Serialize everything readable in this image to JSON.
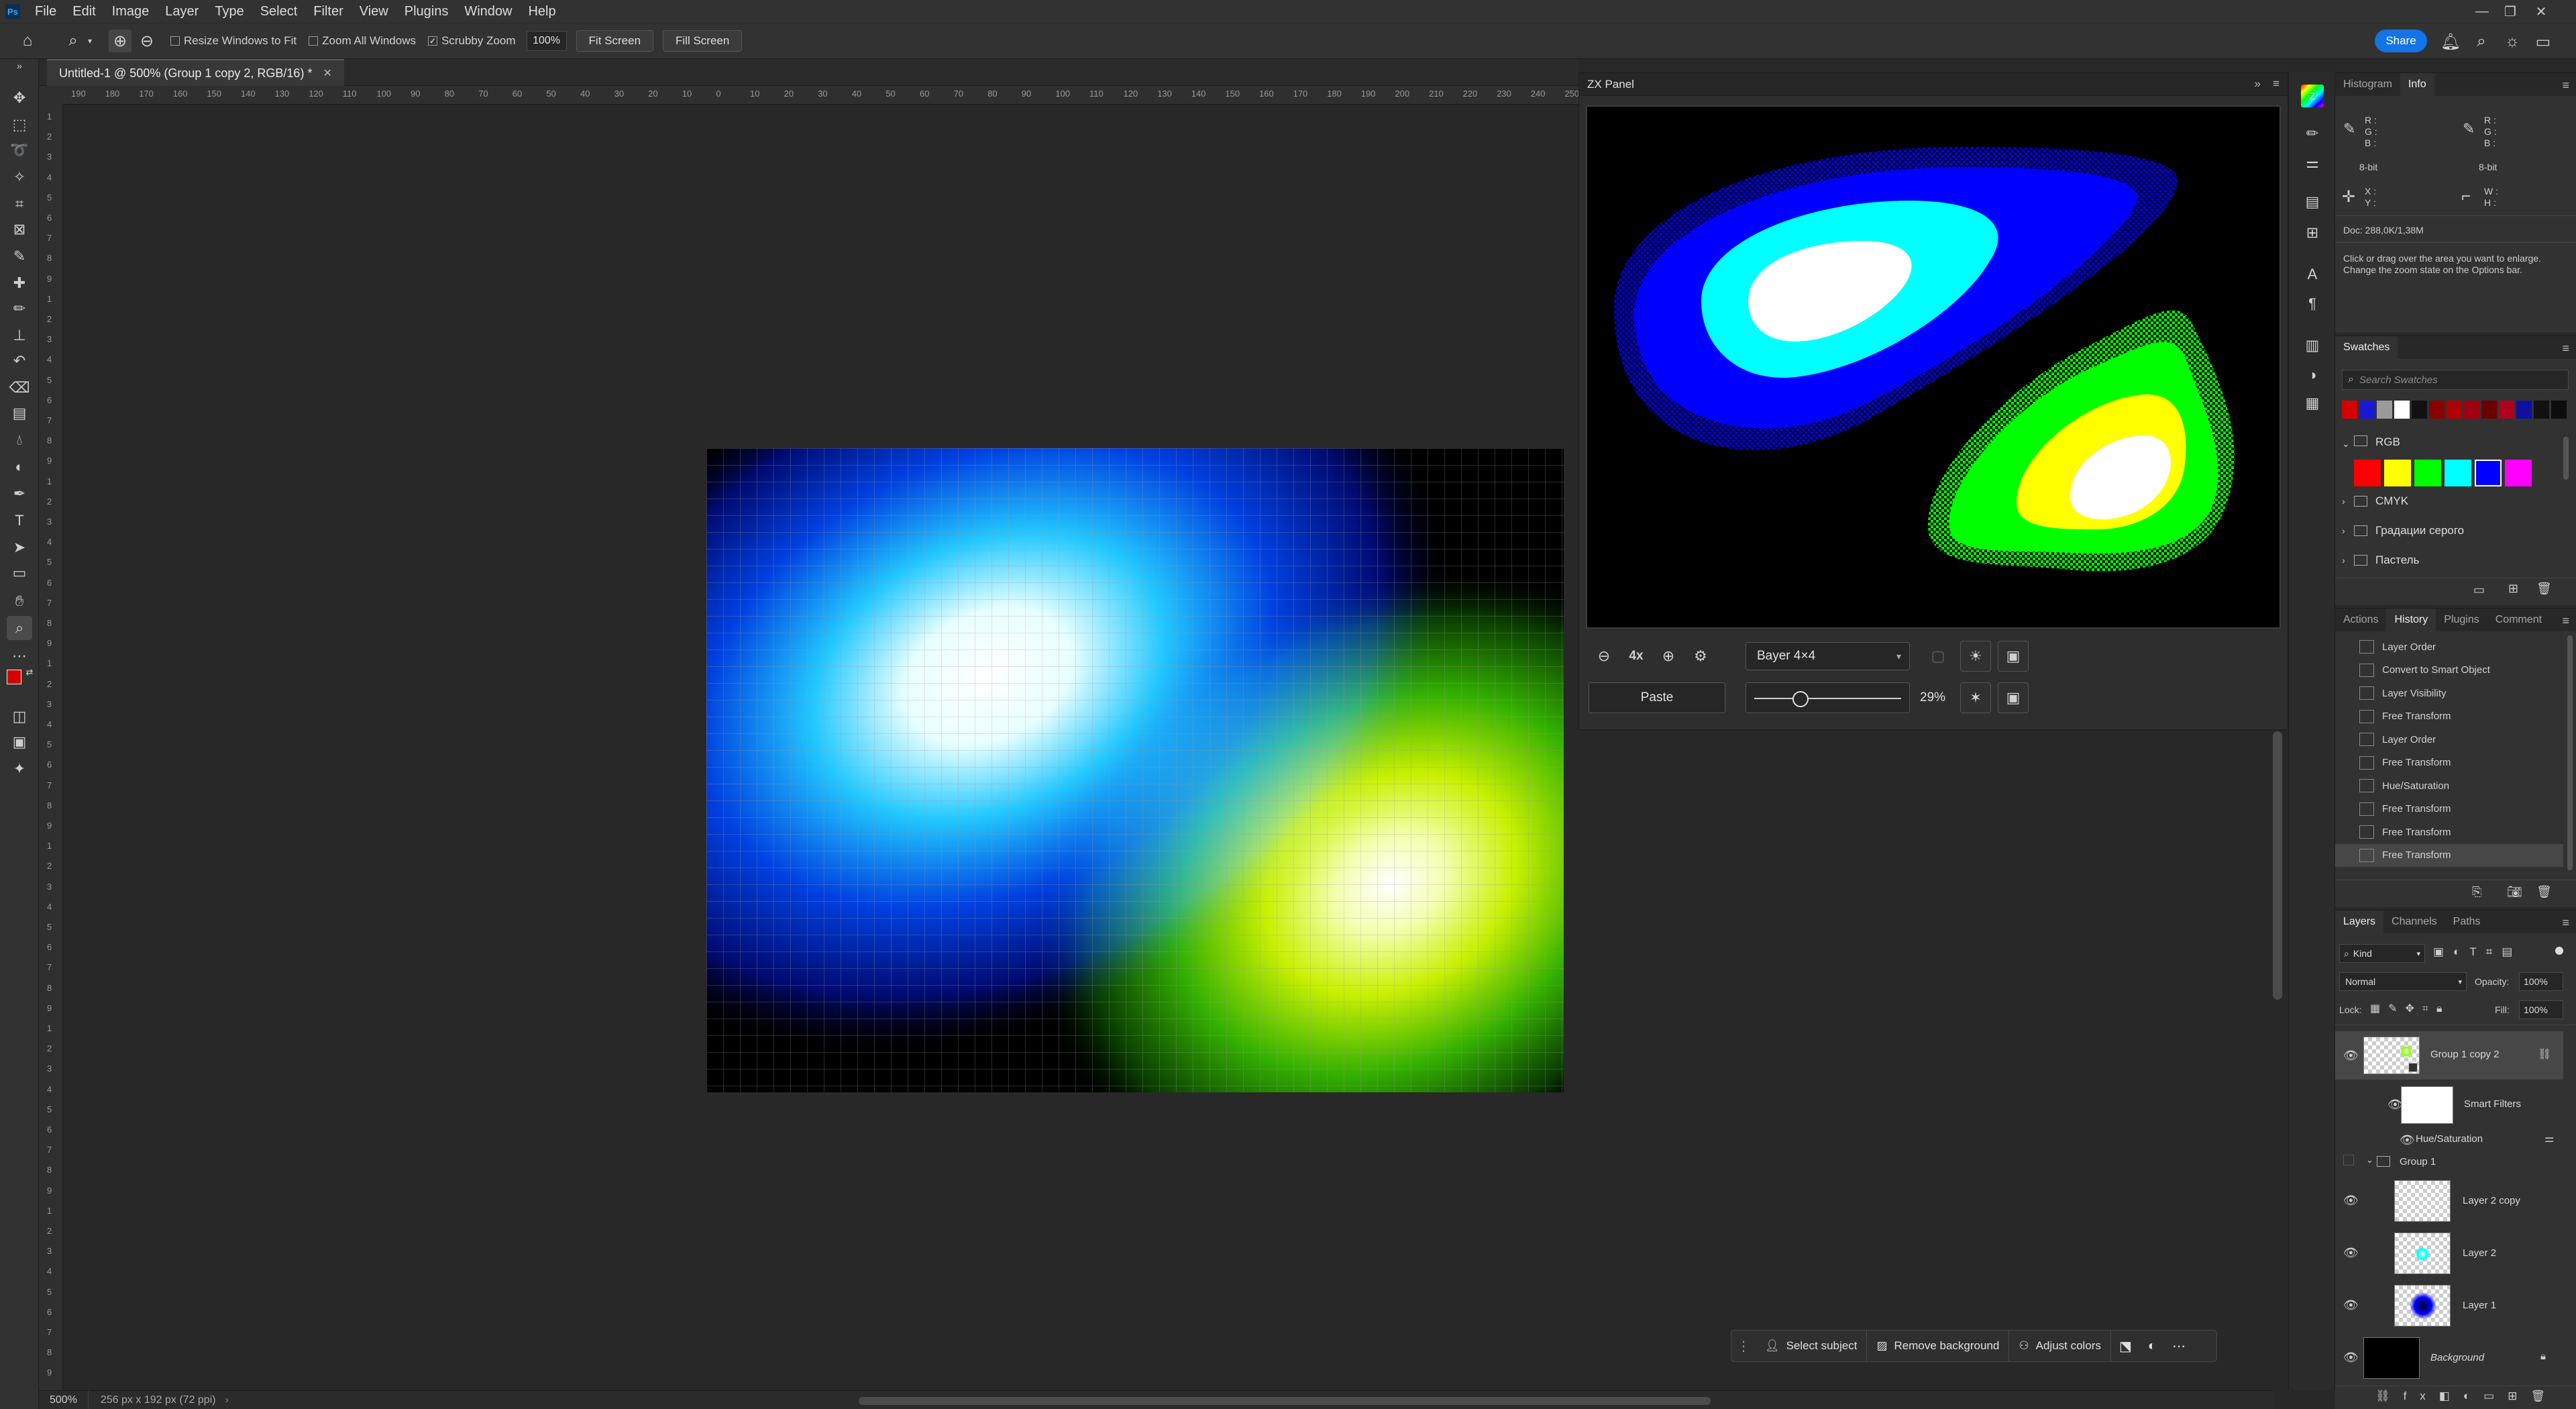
{
  "menubar": {
    "items": [
      "File",
      "Edit",
      "Image",
      "Layer",
      "Type",
      "Select",
      "Filter",
      "View",
      "Plugins",
      "Window",
      "Help"
    ]
  },
  "options": {
    "resize_windows": "Resize Windows to Fit",
    "zoom_all": "Zoom All Windows",
    "scrubby_zoom": "Scrubby Zoom",
    "zoom_value": "100%",
    "fit_screen": "Fit Screen",
    "fill_screen": "Fill Screen",
    "share": "Share"
  },
  "document": {
    "tab_title": "Untitled-1 @ 500% (Group 1 copy 2, RGB/16) *",
    "zoom": "500%",
    "size_info": "256 px x 192 px (72 ppi)"
  },
  "ruler": {
    "h_labels": [
      "190",
      "180",
      "170",
      "160",
      "150",
      "140",
      "130",
      "120",
      "110",
      "100",
      "90",
      "80",
      "70",
      "60",
      "50",
      "40",
      "30",
      "20",
      "10",
      "0",
      "10",
      "20",
      "30",
      "40",
      "50",
      "60",
      "70",
      "80",
      "90",
      "100",
      "110",
      "120",
      "130",
      "140",
      "150",
      "160",
      "170",
      "180",
      "190",
      "200",
      "210",
      "220",
      "230",
      "240",
      "250"
    ],
    "v_labels": [
      "1",
      "2",
      "3",
      "4",
      "5",
      "6",
      "7",
      "8",
      "9",
      "1",
      "2",
      "3",
      "4",
      "5",
      "6",
      "7",
      "8",
      "9",
      "1",
      "2",
      "3",
      "4",
      "5",
      "6",
      "7",
      "8",
      "9",
      "1",
      "2",
      "3",
      "4",
      "5",
      "6",
      "7",
      "8",
      "9",
      "1",
      "2",
      "3",
      "4",
      "5",
      "6",
      "7",
      "8",
      "9",
      "1",
      "2",
      "3",
      "4",
      "5",
      "6",
      "7",
      "8",
      "9",
      "1",
      "2",
      "3",
      "4",
      "5",
      "6",
      "7",
      "8",
      "9"
    ]
  },
  "zx_panel": {
    "title": "ZX Panel",
    "zoom_label": "4x",
    "dither": "Bayer 4×4",
    "paste": "Paste",
    "slider_value": 0.29,
    "slider_label": "29%"
  },
  "info_panel": {
    "tabs": [
      "Histogram",
      "Info"
    ],
    "r": "R :",
    "g": "G :",
    "b": "B :",
    "bit_depth": "8-bit",
    "x": "X :",
    "y": "Y :",
    "w": "W :",
    "h": "H :",
    "doc": "Doc: 288,0K/1,38M",
    "hint_line1": "Click or drag over the area you want to enlarge.",
    "hint_line2": "Change the zoom state on the Options bar."
  },
  "swatches_panel": {
    "tab": "Swatches",
    "search_placeholder": "Search Swatches",
    "recent_colors": [
      "#d40000",
      "#1919d4",
      "#9a9a9a",
      "#ffffff",
      "#111111",
      "#8b0000",
      "#b00000",
      "#a00010",
      "#6a0000",
      "#b00020",
      "#1010a0",
      "#111111",
      "#0d0d0d"
    ],
    "groups": [
      "RGB",
      "CMYK",
      "Градации серого",
      "Пастель"
    ],
    "rgb_colors": [
      "#ff0000",
      "#ffff00",
      "#00ff00",
      "#00ffff",
      "#0000ff",
      "#ff00ff"
    ]
  },
  "history_panel": {
    "tabs": [
      "Actions",
      "History",
      "Plugins",
      "Comment"
    ],
    "items": [
      "Layer Order",
      "Convert to Smart Object",
      "Layer Visibility",
      "Free Transform",
      "Layer Order",
      "Free Transform",
      "Hue/Saturation",
      "Free Transform",
      "Free Transform",
      "Free Transform"
    ]
  },
  "layers_panel": {
    "tabs": [
      "Layers",
      "Channels",
      "Paths"
    ],
    "kind": "Kind",
    "blend_mode": "Normal",
    "opacity_label": "Opacity:",
    "opacity": "100%",
    "lock_label": "Lock:",
    "fill_label": "Fill:",
    "fill": "100%",
    "layers": {
      "group_copy": "Group 1 copy 2",
      "smart_filters": "Smart Filters",
      "hue_sat": "Hue/Saturation",
      "group1": "Group 1",
      "layer2copy": "Layer 2 copy",
      "layer2": "Layer 2",
      "layer1": "Layer 1",
      "background": "Background"
    }
  },
  "taskbar": {
    "select_subject": "Select subject",
    "remove_background": "Remove background",
    "adjust_colors": "Adjust colors"
  }
}
